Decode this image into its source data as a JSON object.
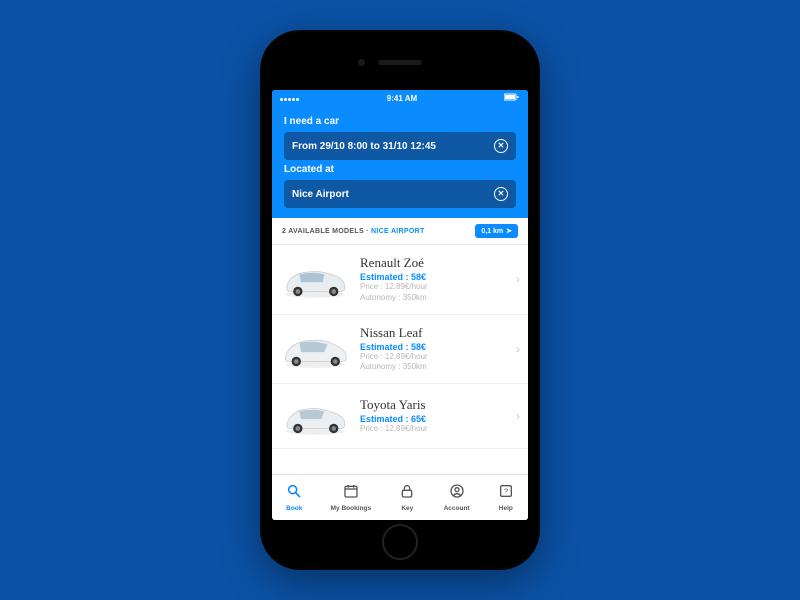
{
  "statusbar": {
    "time": "9:41 AM"
  },
  "header": {
    "label_need": "I need a car",
    "date_value": "From 29/10 8:00 to 31/10 12:45",
    "label_located": "Located at",
    "location_value": "Nice Airport"
  },
  "subbar": {
    "count": "2",
    "text": "AVAILABLE MODELS",
    "location": "NICE AIRPORT",
    "distance": "0,1 km"
  },
  "cars": [
    {
      "model": "Renault Zoé",
      "estimated_label": "Estimated :",
      "estimated_value": "58€",
      "price": "Price : 12,89€/hour",
      "autonomy": "Autonomy : 350km"
    },
    {
      "model": "Nissan Leaf",
      "estimated_label": "Estimated :",
      "estimated_value": "58€",
      "price": "Price : 12,89€/hour",
      "autonomy": "Autonomy : 350km"
    },
    {
      "model": "Toyota Yaris",
      "estimated_label": "Estimated :",
      "estimated_value": "65€",
      "price": "Price : 12,89€/hour",
      "autonomy": ""
    }
  ],
  "tabs": {
    "book": "Book",
    "bookings": "My Bookings",
    "key": "Key",
    "account": "Account",
    "help": "Help"
  },
  "colors": {
    "accent": "#0a8cff",
    "pill": "#0e58a4",
    "bg": "#0b52a6"
  }
}
